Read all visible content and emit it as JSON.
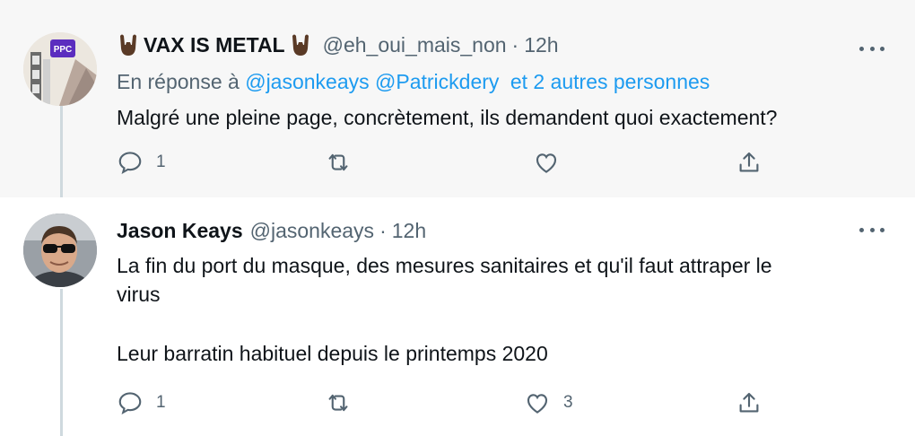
{
  "tweets": [
    {
      "name": "VAX IS METAL",
      "handle": "@eh_oui_mais_non",
      "time": "12h",
      "reply_prefix": "En réponse à",
      "mentions": [
        "@jasonkeays",
        "@Patrickdery"
      ],
      "others": "et 2 autres personnes",
      "text": "Malgré une pleine page, concrètement, ils demandent quoi exactement?",
      "avatar_badge": "PPC",
      "reply_count": "1",
      "retweet_count": "",
      "like_count": ""
    },
    {
      "name": "Jason Keays",
      "handle": "@jasonkeays",
      "time": "12h",
      "text_line1": "La fin du port du masque, des mesures sanitaires et qu'il faut attraper le",
      "text_line2": "virus",
      "text_line3": "Leur barratin habituel depuis le printemps 2020",
      "reply_count": "1",
      "retweet_count": "",
      "like_count": "3"
    }
  ],
  "separator": "·",
  "colors": {
    "accent": "#1d9bf0",
    "muted": "#536471",
    "text": "#0f1419",
    "highlight_bg": "#f7f7f7"
  },
  "icons": [
    "sign-of-horns-emoji",
    "more-icon",
    "reply-icon",
    "retweet-icon",
    "like-icon",
    "share-icon"
  ]
}
